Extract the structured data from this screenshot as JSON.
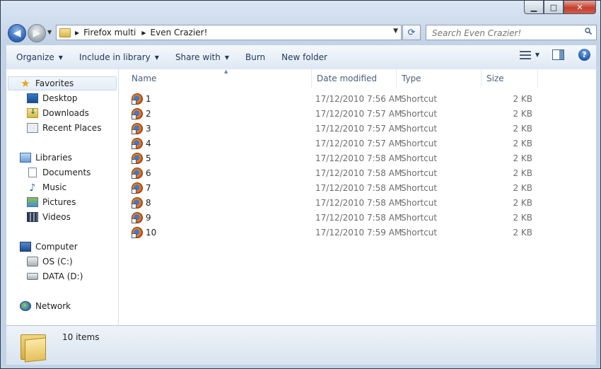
{
  "window": {
    "caption": {
      "minimize": "▁",
      "maximize": "□",
      "close": "✕"
    }
  },
  "navigation": {
    "back_icon": "back-arrow-icon",
    "forward_icon": "forward-arrow-icon",
    "address_segments": [
      "Firefox multi",
      "Even Crazier!"
    ],
    "search_placeholder": "Search Even Crazier!"
  },
  "toolbar": {
    "organize": "Organize",
    "include_in_library": "Include in library",
    "share_with": "Share with",
    "burn": "Burn",
    "new_folder": "New folder",
    "help": "?"
  },
  "sidebar": {
    "favorites": {
      "label": "Favorites",
      "items": [
        "Desktop",
        "Downloads",
        "Recent Places"
      ]
    },
    "libraries": {
      "label": "Libraries",
      "items": [
        "Documents",
        "Music",
        "Pictures",
        "Videos"
      ]
    },
    "computer": {
      "label": "Computer",
      "items": [
        "OS (C:)",
        "DATA (D:)"
      ]
    },
    "network": {
      "label": "Network"
    }
  },
  "columns": {
    "name": "Name",
    "date_modified": "Date modified",
    "type": "Type",
    "size": "Size"
  },
  "files": [
    {
      "name": "1",
      "date": "17/12/2010 7:56 AM",
      "type": "Shortcut",
      "size": "2 KB"
    },
    {
      "name": "2",
      "date": "17/12/2010 7:57 AM",
      "type": "Shortcut",
      "size": "2 KB"
    },
    {
      "name": "3",
      "date": "17/12/2010 7:57 AM",
      "type": "Shortcut",
      "size": "2 KB"
    },
    {
      "name": "4",
      "date": "17/12/2010 7:57 AM",
      "type": "Shortcut",
      "size": "2 KB"
    },
    {
      "name": "5",
      "date": "17/12/2010 7:58 AM",
      "type": "Shortcut",
      "size": "2 KB"
    },
    {
      "name": "6",
      "date": "17/12/2010 7:58 AM",
      "type": "Shortcut",
      "size": "2 KB"
    },
    {
      "name": "7",
      "date": "17/12/2010 7:58 AM",
      "type": "Shortcut",
      "size": "2 KB"
    },
    {
      "name": "8",
      "date": "17/12/2010 7:58 AM",
      "type": "Shortcut",
      "size": "2 KB"
    },
    {
      "name": "9",
      "date": "17/12/2010 7:58 AM",
      "type": "Shortcut",
      "size": "2 KB"
    },
    {
      "name": "10",
      "date": "17/12/2010 7:59 AM",
      "type": "Shortcut",
      "size": "2 KB"
    }
  ],
  "status": {
    "item_count": "10 items"
  }
}
